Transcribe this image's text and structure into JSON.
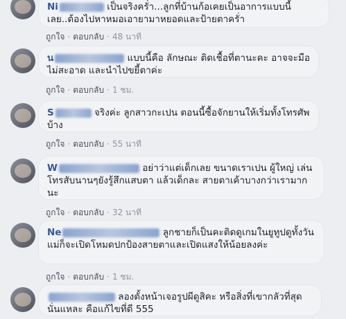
{
  "comments": [
    {
      "author_prefix": "Ni",
      "text": "เป็นจริงครั่า...ลูกที่บ้านก้อเคยเป็นอาการแบบนี้เลย..ต้องไปหาหมอเอายามาหยอดและป้ายตาครั่า",
      "like": "ถูกใจ",
      "reply": "ตอบกลับ",
      "time": "48 นาที"
    },
    {
      "author_prefix": "น",
      "text": "แบบนี้คือ ลักษณะ ติดเชื้อที่ตานะคะ อาจจะมือไม่สะอาด และนำไปขยี้ตาค่ะ",
      "like": "ถูกใจ",
      "reply": "ตอบกลับ",
      "time": "1 ชม."
    },
    {
      "author_prefix": "S",
      "text": "จริงค่ะ ลูกสาวกะเปน ตอนนี้ซื้อจักยานให้เริ่มทั้งโทรศัพบ้าง",
      "like": "ถูกใจ",
      "reply": "ตอบกลับ",
      "time": "55 นาที"
    },
    {
      "author_prefix": "W",
      "text": "อย่าว่าแต่เด็กเลย ขนาดเราเปน ผู้ใหญ่ เล่นโทรสับนานๆยังรู้สึกแสบตา แล้วเด็กละ สายตาเค้าบางกว่าเรามากนะ",
      "like": "ถูกใจ",
      "reply": "ตอบกลับ",
      "time": "32 นาที"
    },
    {
      "author_prefix": "Ne",
      "text": "ลูกชายก็เป็นคะติดดูเกมในยูทูปดูทั้งวัน แม่ก็จะเปิดโหมดปกป้องสายตาและเปิดแสงให้น้อยลงค่ะ",
      "like": "ถูกใจ",
      "reply": "ตอบกลับ",
      "time": "1 ชม."
    },
    {
      "author_prefix": "",
      "text": "ลองตั้งหน้าเจอรูปผีดูสิคะ หรือสิ่งที่เขากลัวที่สุดนั่นแหละ คือแก้ไขที่ดี 555",
      "like": "",
      "reply": "",
      "time": ""
    }
  ]
}
